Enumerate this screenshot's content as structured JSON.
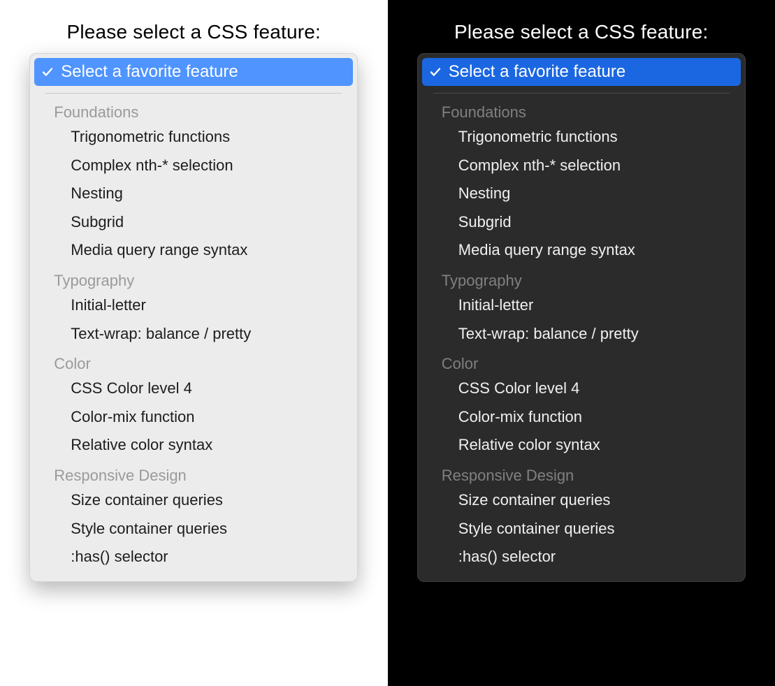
{
  "prompt": "Please select a CSS feature:",
  "selected": {
    "label": "Select a favorite feature",
    "icon": "check-icon"
  },
  "colors": {
    "light_accent": "#4f94ff",
    "dark_accent": "#1b67e2",
    "light_bg": "#ececec",
    "dark_bg": "#2b2b2b"
  },
  "groups": [
    {
      "label": "Foundations",
      "options": [
        "Trigonometric functions",
        "Complex nth-* selection",
        "Nesting",
        "Subgrid",
        "Media query range syntax"
      ]
    },
    {
      "label": "Typography",
      "options": [
        "Initial-letter",
        "Text-wrap: balance / pretty"
      ]
    },
    {
      "label": "Color",
      "options": [
        "CSS Color level 4",
        "Color-mix function",
        "Relative color syntax"
      ]
    },
    {
      "label": "Responsive Design",
      "options": [
        "Size container queries",
        "Style container queries",
        ":has() selector"
      ]
    }
  ]
}
